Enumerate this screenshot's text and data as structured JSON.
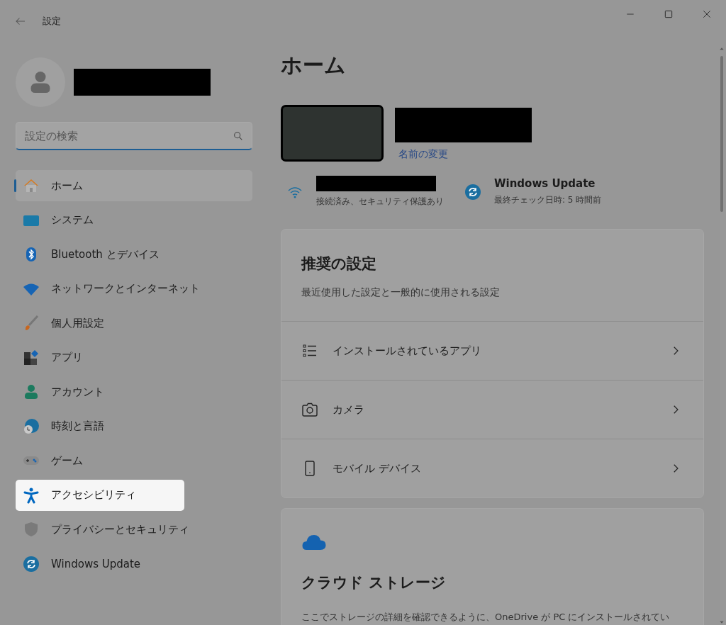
{
  "window": {
    "title": "設定"
  },
  "search": {
    "placeholder": "設定の検索"
  },
  "nav": [
    {
      "label": "ホーム",
      "selected": true,
      "highlighted": false
    },
    {
      "label": "システム",
      "selected": false,
      "highlighted": false
    },
    {
      "label": "Bluetooth とデバイス",
      "selected": false,
      "highlighted": false
    },
    {
      "label": "ネットワークとインターネット",
      "selected": false,
      "highlighted": false
    },
    {
      "label": "個人用設定",
      "selected": false,
      "highlighted": false
    },
    {
      "label": "アプリ",
      "selected": false,
      "highlighted": false
    },
    {
      "label": "アカウント",
      "selected": false,
      "highlighted": false
    },
    {
      "label": "時刻と言語",
      "selected": false,
      "highlighted": false
    },
    {
      "label": "ゲーム",
      "selected": false,
      "highlighted": false
    },
    {
      "label": "アクセシビリティ",
      "selected": false,
      "highlighted": true
    },
    {
      "label": "プライバシーとセキュリティ",
      "selected": false,
      "highlighted": false
    },
    {
      "label": "Windows Update",
      "selected": false,
      "highlighted": false
    }
  ],
  "main": {
    "title": "ホーム",
    "device": {
      "rename_link": "名前の変更"
    },
    "network": {
      "status": "接続済み、セキュリティ保護あり"
    },
    "update": {
      "title": "Windows Update",
      "status": "最終チェック日時: 5 時間前"
    },
    "recommended": {
      "title": "推奨の設定",
      "subtitle": "最近使用した設定と一般的に使用される設定",
      "items": [
        {
          "label": "インストールされているアプリ"
        },
        {
          "label": "カメラ"
        },
        {
          "label": "モバイル デバイス"
        }
      ]
    },
    "cloud": {
      "title": "クラウド ストレージ",
      "text": "ここでストレージの詳細を確認できるように、OneDrive が PC にインストールされてい"
    }
  }
}
